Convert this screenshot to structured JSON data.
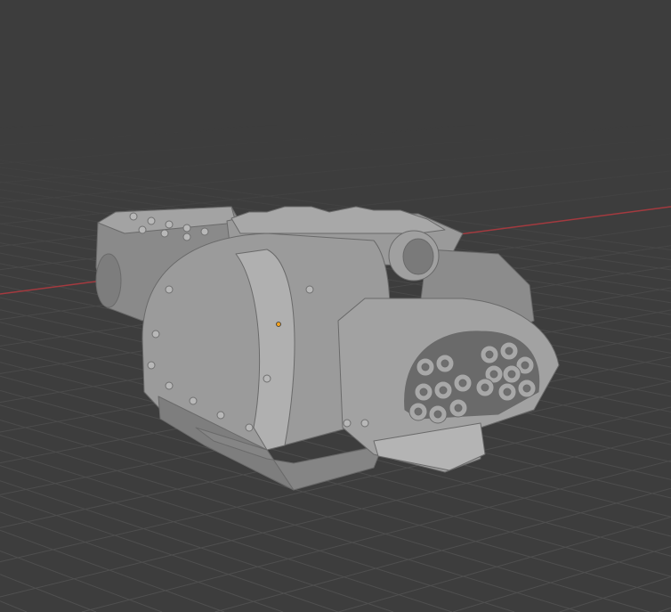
{
  "viewport": {
    "background": "#3d3d3d",
    "grid_color": "#505050",
    "x_axis_color": "#a33a3f",
    "model_color": "#8f8f8f",
    "origin_color": "#f0a020"
  }
}
